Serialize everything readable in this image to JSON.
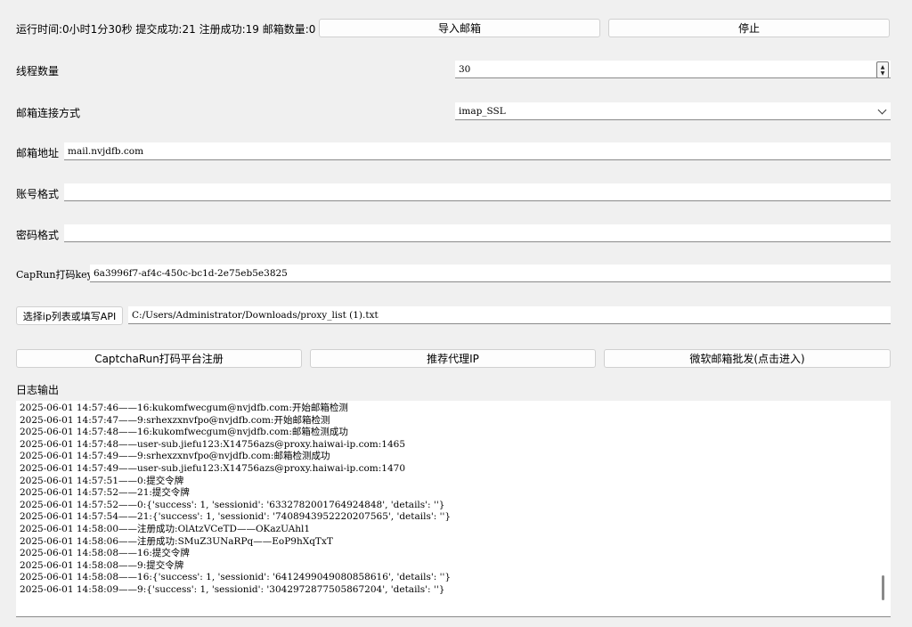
{
  "status": {
    "runtime": "运行时间:0小时1分30秒",
    "submitted": "提交成功:21",
    "registered": "注册成功:19",
    "mailbox_count": "邮箱数量:0"
  },
  "buttons": {
    "import_mail": "导入邮箱",
    "stop": "停止",
    "select_ip": "选择ip列表或填写API",
    "captcha_register": "CaptchaRun打码平台注册",
    "recommend_proxy": "推荐代理IP",
    "ms_mail_bulk": "微软邮箱批发(点击进入)"
  },
  "form": {
    "threads_label": "线程数量",
    "threads_value": "30",
    "conn_label": "邮箱连接方式",
    "conn_value": "imap_SSL",
    "address_label": "邮箱地址",
    "address_value": "mail.nvjdfb.com",
    "account_label": "账号格式",
    "account_value": "",
    "password_label": "密码格式",
    "password_value": "",
    "capkey_label": "CapRun打码key",
    "capkey_value": "6a3996f7-af4c-450c-bc1d-2e75eb5e3825",
    "ip_path_value": "C:/Users/Administrator/Downloads/proxy_list (1).txt"
  },
  "log": {
    "title": "日志输出",
    "lines": [
      "2025-06-01 14:57:46——16:kukomfwecgum@nvjdfb.com:开始邮箱检测",
      "2025-06-01 14:57:47——9:srhexzxnvfpo@nvjdfb.com:开始邮箱检测",
      "2025-06-01 14:57:48——16:kukomfwecgum@nvjdfb.com:邮箱检测成功",
      "2025-06-01 14:57:48——user-sub.jiefu123:X14756azs@proxy.haiwai-ip.com:1465",
      "2025-06-01 14:57:49——9:srhexzxnvfpo@nvjdfb.com:邮箱检测成功",
      "2025-06-01 14:57:49——user-sub.jiefu123:X14756azs@proxy.haiwai-ip.com:1470",
      "2025-06-01 14:57:51——0:提交令牌",
      "2025-06-01 14:57:52——21:提交令牌",
      "2025-06-01 14:57:52——0:{'success': 1, 'sessionid': '6332782001764924848', 'details': ''}",
      "2025-06-01 14:57:54——21:{'success': 1, 'sessionid': '7408943952220207565', 'details': ''}",
      "2025-06-01 14:58:00——注册成功:OlAtzVCeTD——OKazUAhl1",
      "2025-06-01 14:58:06——注册成功:SMuZ3UNaRPq——EoP9hXqTxT",
      "2025-06-01 14:58:08——16:提交令牌",
      "2025-06-01 14:58:08——9:提交令牌",
      "2025-06-01 14:58:08——16:{'success': 1, 'sessionid': '6412499049080858616', 'details': ''}",
      "2025-06-01 14:58:09——9:{'success': 1, 'sessionid': '3042972877505867204', 'details': ''}"
    ]
  }
}
